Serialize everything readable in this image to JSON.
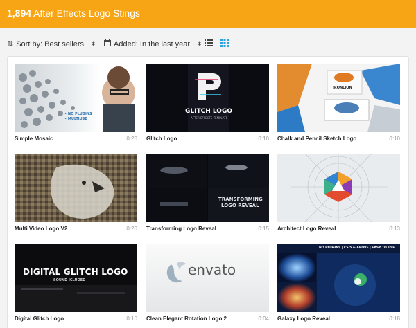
{
  "header": {
    "count": "1,894",
    "title": "After Effects Logo Stings"
  },
  "filters": {
    "sort_label": "Sort by: Best sellers",
    "added_label": "Added: In the last year",
    "list_view_icon": "list-icon",
    "grid_view_icon": "grid-icon"
  },
  "colors": {
    "brand": "#f7a515",
    "active_view": "#2aa4e0"
  },
  "items": [
    {
      "name": "Simple Mosaic",
      "duration": "0:20",
      "thumb_text": "• NO PLUGINS\n• MULTIUSE"
    },
    {
      "name": "Glitch Logo",
      "duration": "0:10",
      "thumb_text": "GLITCH LOGO",
      "thumb_sub": "AFTER EFFECTS TEMPLATE"
    },
    {
      "name": "Chalk and Pencil Sketch Logo",
      "duration": "0:10",
      "thumb_text": "IRONLION"
    },
    {
      "name": "Multi Video Logo V2",
      "duration": "0:20"
    },
    {
      "name": "Transforming Logo Reveal",
      "duration": "0:15",
      "thumb_text": "TRANSFORMING",
      "thumb_sub": "LOGO REVEAL"
    },
    {
      "name": "Architect Logo Reveal",
      "duration": "0:13"
    },
    {
      "name": "Digital Glitch Logo",
      "duration": "0:10",
      "thumb_text": "DIGITAL GLITCH LOGO",
      "thumb_sub": "SOUND ICLUDED"
    },
    {
      "name": "Clean Elegant Rotation Logo 2",
      "duration": "0:04",
      "thumb_text": "envato"
    },
    {
      "name": "Galaxy Logo Reveal",
      "duration": "0:18",
      "thumb_text": "NO PLUGINS | CS 5 & ABOVE | EASY TO USE"
    }
  ]
}
